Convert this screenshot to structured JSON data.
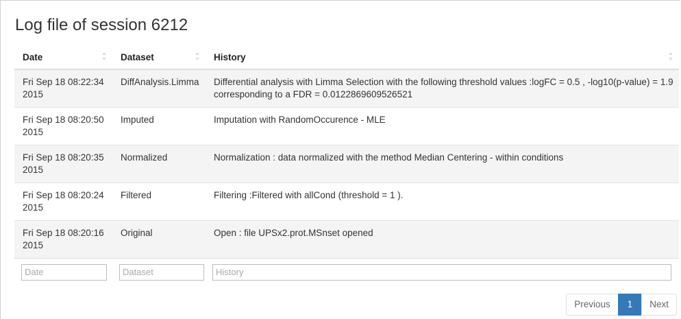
{
  "page": {
    "title": "Log file of session 6212"
  },
  "table": {
    "columns": [
      {
        "label": "Date"
      },
      {
        "label": "Dataset"
      },
      {
        "label": "History"
      }
    ],
    "rows": [
      {
        "date": "Fri Sep 18 08:22:34 2015",
        "dataset": "DiffAnalysis.Limma",
        "history": "Differential analysis with Limma Selection with the following threshold values :logFC = 0.5 , -log10(p-value) = 1.9 corresponding to a FDR = 0.0122869609526521"
      },
      {
        "date": "Fri Sep 18 08:20:50 2015",
        "dataset": "Imputed",
        "history": "Imputation with RandomOccurence - MLE"
      },
      {
        "date": "Fri Sep 18 08:20:35 2015",
        "dataset": "Normalized",
        "history": "Normalization : data normalized with the method Median Centering - within conditions"
      },
      {
        "date": "Fri Sep 18 08:20:24 2015",
        "dataset": "Filtered",
        "history": "Filtering :Filtered with allCond (threshold = 1 )."
      },
      {
        "date": "Fri Sep 18 08:20:16 2015",
        "dataset": "Original",
        "history": "Open : file UPSx2.prot.MSnset opened"
      }
    ],
    "filters": {
      "date_placeholder": "Date",
      "dataset_placeholder": "Dataset",
      "history_placeholder": "History"
    }
  },
  "pagination": {
    "previous_label": "Previous",
    "current_page": "1",
    "next_label": "Next"
  },
  "colors": {
    "accent": "#337ab7",
    "stripe": "#f4f4f4"
  },
  "icons": {
    "sort": "sort-both-icon"
  }
}
